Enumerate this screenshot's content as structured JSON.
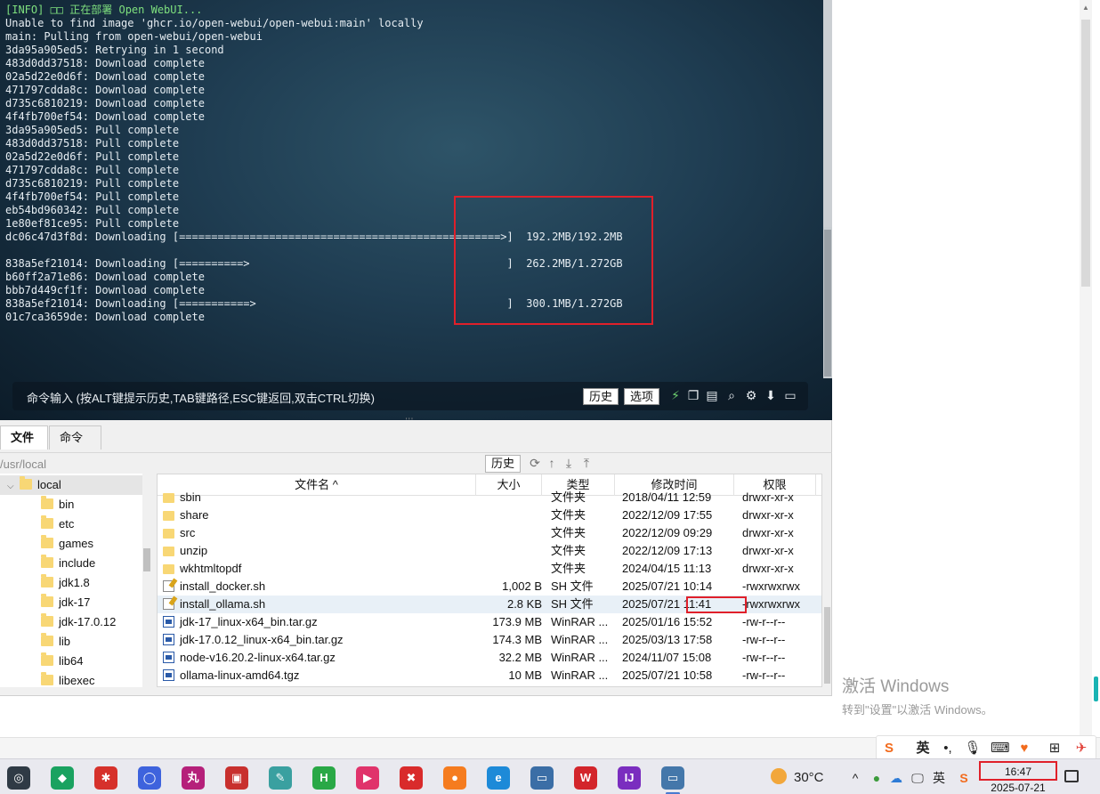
{
  "terminal": {
    "lines": [
      {
        "text": "[INFO] □□ 正在部署 Open WebUI...",
        "style": "green"
      },
      {
        "text": "Unable to find image 'ghcr.io/open-webui/open-webui:main' locally"
      },
      {
        "text": "main: Pulling from open-webui/open-webui"
      },
      {
        "text": "3da95a905ed5: Retrying in 1 second"
      },
      {
        "text": "483d0dd37518: Download complete"
      },
      {
        "text": "02a5d22e0d6f: Download complete"
      },
      {
        "text": "471797cdda8c: Download complete"
      },
      {
        "text": "d735c6810219: Download complete"
      },
      {
        "text": "4f4fb700ef54: Download complete"
      },
      {
        "text": "3da95a905ed5: Pull complete"
      },
      {
        "text": "483d0dd37518: Pull complete"
      },
      {
        "text": "02a5d22e0d6f: Pull complete"
      },
      {
        "text": "471797cdda8c: Pull complete"
      },
      {
        "text": "d735c6810219: Pull complete"
      },
      {
        "text": "4f4fb700ef54: Pull complete"
      },
      {
        "text": "eb54bd960342: Pull complete"
      },
      {
        "text": "1e80ef81ce95: Pull complete"
      },
      {
        "text": "dc06c47d3f8d: Downloading [==================================================>]  192.2MB/192.2MB"
      },
      {
        "text": ""
      },
      {
        "text": "838a5ef21014: Downloading [==========>                                        ]  262.2MB/1.272GB"
      },
      {
        "text": "b60ff2a71e86: Download complete"
      },
      {
        "text": "bbb7d449cf1f: Download complete"
      },
      {
        "text": "838a5ef21014: Downloading [===========>                                       ]  300.1MB/1.272GB"
      },
      {
        "text": "01c7ca3659de: Download complete"
      }
    ],
    "command_hint": "命令输入 (按ALT键提示历史,TAB键路径,ESC键返回,双击CTRL切换)",
    "history_label": "历史",
    "options_label": "选项",
    "icons": [
      "bolt-icon",
      "copy-icon",
      "paste-icon",
      "search-icon",
      "gear-icon",
      "download-arrow-icon",
      "maximize-icon"
    ],
    "accent": "#e0202a"
  },
  "file_manager": {
    "tabs": [
      "文件",
      "命令"
    ],
    "path": "/usr/local",
    "history_label": "历史",
    "tree": [
      {
        "label": "local",
        "expanded": true,
        "selected": true
      },
      {
        "label": "bin"
      },
      {
        "label": "etc"
      },
      {
        "label": "games"
      },
      {
        "label": "include"
      },
      {
        "label": "jdk1.8"
      },
      {
        "label": "jdk-17"
      },
      {
        "label": "jdk-17.0.12"
      },
      {
        "label": "lib"
      },
      {
        "label": "lib64"
      },
      {
        "label": "libexec"
      }
    ],
    "columns": [
      "文件名",
      "大小",
      "类型",
      "修改时间",
      "权限"
    ],
    "rows": [
      {
        "name": "sbin",
        "size": "",
        "type": "文件夹",
        "date": "2018/04/11 12:59",
        "perm": "drwxr-xr-x",
        "icon": "folder"
      },
      {
        "name": "share",
        "size": "",
        "type": "文件夹",
        "date": "2022/12/09 17:55",
        "perm": "drwxr-xr-x",
        "icon": "folder"
      },
      {
        "name": "src",
        "size": "",
        "type": "文件夹",
        "date": "2022/12/09 09:29",
        "perm": "drwxr-xr-x",
        "icon": "folder"
      },
      {
        "name": "unzip",
        "size": "",
        "type": "文件夹",
        "date": "2022/12/09 17:13",
        "perm": "drwxr-xr-x",
        "icon": "folder"
      },
      {
        "name": "wkhtmltopdf",
        "size": "",
        "type": "文件夹",
        "date": "2024/04/15 11:13",
        "perm": "drwxr-xr-x",
        "icon": "folder"
      },
      {
        "name": "install_docker.sh",
        "size": "1,002 B",
        "type": "SH 文件",
        "date": "2025/07/21 10:14",
        "perm": "-rwxrwxrwx",
        "icon": "sh"
      },
      {
        "name": "install_ollama.sh",
        "size": "2.8 KB",
        "type": "SH 文件",
        "date": "2025/07/21 11:41",
        "perm": "-rwxrwxrwx",
        "icon": "sh",
        "selected": true
      },
      {
        "name": "jdk-17_linux-x64_bin.tar.gz",
        "size": "173.9 MB",
        "type": "WinRAR ...",
        "date": "2025/01/16 15:52",
        "perm": "-rw-r--r--",
        "icon": "rar"
      },
      {
        "name": "jdk-17.0.12_linux-x64_bin.tar.gz",
        "size": "174.3 MB",
        "type": "WinRAR ...",
        "date": "2025/03/13 17:58",
        "perm": "-rw-r--r--",
        "icon": "rar"
      },
      {
        "name": "node-v16.20.2-linux-x64.tar.gz",
        "size": "32.2 MB",
        "type": "WinRAR ...",
        "date": "2024/11/07 15:08",
        "perm": "-rw-r--r--",
        "icon": "rar"
      },
      {
        "name": "ollama-linux-amd64.tgz",
        "size": "10 MB",
        "type": "WinRAR ...",
        "date": "2025/07/21 10:58",
        "perm": "-rw-r--r--",
        "icon": "rar"
      }
    ]
  },
  "watermark": {
    "title": "激活 Windows",
    "subtitle": "转到\"设置\"以激活 Windows。"
  },
  "ime": {
    "lang": "英",
    "icons": [
      "sogou-icon",
      "punctuation-icon",
      "microphone-icon",
      "keyboard-icon",
      "skin-icon",
      "apps-grid-icon",
      "toolbox-icon"
    ]
  },
  "taskbar": {
    "apps": [
      {
        "name": "app-1-icon",
        "color": "#2f3a45",
        "glyph": "◎"
      },
      {
        "name": "app-2-icon",
        "color": "#1aa260",
        "glyph": "◆"
      },
      {
        "name": "app-3-icon",
        "color": "#d6312b",
        "glyph": "✱"
      },
      {
        "name": "app-4-icon",
        "color": "#3e63dd",
        "glyph": "◯"
      },
      {
        "name": "app-5-icon",
        "color": "#b5207a",
        "glyph": "丸"
      },
      {
        "name": "app-6-icon",
        "color": "#c8302e",
        "glyph": "▣"
      },
      {
        "name": "app-7-icon",
        "color": "#3aa0a0",
        "glyph": "✎"
      },
      {
        "name": "app-8-icon",
        "color": "#29a846",
        "glyph": "H"
      },
      {
        "name": "app-9-icon",
        "color": "#e0336b",
        "glyph": "▶"
      },
      {
        "name": "app-10-icon",
        "color": "#d92b2b",
        "glyph": "✖"
      },
      {
        "name": "app-11-icon",
        "color": "#f57c1f",
        "glyph": "●"
      },
      {
        "name": "app-12-icon",
        "color": "#1d8ad8",
        "glyph": "e"
      },
      {
        "name": "app-13-icon",
        "color": "#3b6ea6",
        "glyph": "▭"
      },
      {
        "name": "app-14-icon",
        "color": "#d3252b",
        "glyph": "W"
      },
      {
        "name": "app-15-icon",
        "color": "#7a2dbf",
        "glyph": "IJ"
      },
      {
        "name": "app-16-icon",
        "color": "#4477aa",
        "glyph": "▭",
        "active": true
      }
    ],
    "temperature": "30°C",
    "tray_lang": "英",
    "time": "16:47",
    "date": "2025-07-21"
  }
}
